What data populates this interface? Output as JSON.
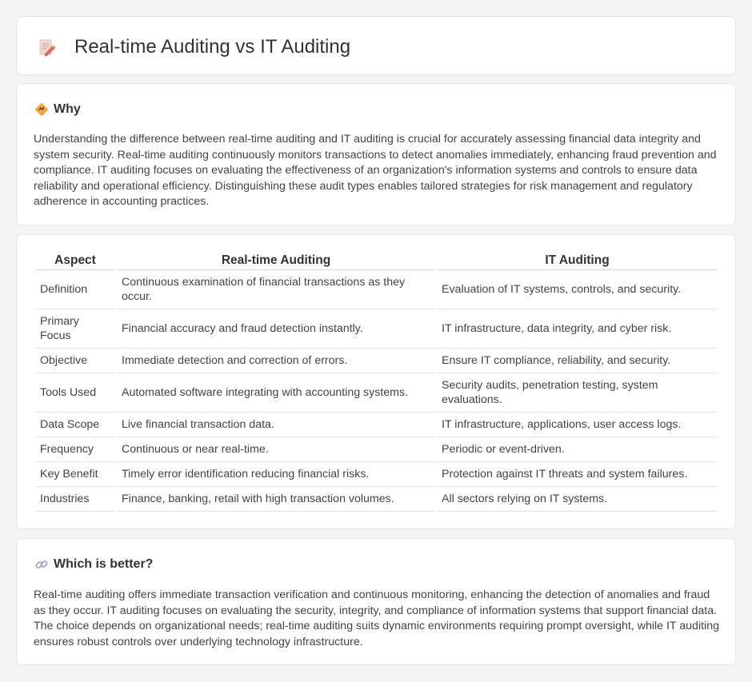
{
  "header": {
    "title": "Real-time Auditing vs IT Auditing",
    "icon": "edit-document-icon"
  },
  "why": {
    "heading": "Why",
    "icon": "diamond-sign-icon",
    "text": "Understanding the difference between real-time auditing and IT auditing is crucial for accurately assessing financial data integrity and system security. Real-time auditing continuously monitors transactions to detect anomalies immediately, enhancing fraud prevention and compliance. IT auditing focuses on evaluating the effectiveness of an organization's information systems and controls to ensure data reliability and operational efficiency. Distinguishing these audit types enables tailored strategies for risk management and regulatory adherence in accounting practices."
  },
  "table": {
    "headers": [
      "Aspect",
      "Real-time Auditing",
      "IT Auditing"
    ],
    "rows": [
      [
        "Definition",
        "Continuous examination of financial transactions as they occur.",
        "Evaluation of IT systems, controls, and security."
      ],
      [
        "Primary Focus",
        "Financial accuracy and fraud detection instantly.",
        "IT infrastructure, data integrity, and cyber risk."
      ],
      [
        "Objective",
        "Immediate detection and correction of errors.",
        "Ensure IT compliance, reliability, and security."
      ],
      [
        "Tools Used",
        "Automated software integrating with accounting systems.",
        "Security audits, penetration testing, system evaluations."
      ],
      [
        "Data Scope",
        "Live financial transaction data.",
        "IT infrastructure, applications, user access logs."
      ],
      [
        "Frequency",
        "Continuous or near real-time.",
        "Periodic or event-driven."
      ],
      [
        "Key Benefit",
        "Timely error identification reducing financial risks.",
        "Protection against IT threats and system failures."
      ],
      [
        "Industries",
        "Finance, banking, retail with high transaction volumes.",
        "All sectors relying on IT systems."
      ]
    ]
  },
  "better": {
    "heading": "Which is better?",
    "icon": "link-icon",
    "text": "Real-time auditing offers immediate transaction verification and continuous monitoring, enhancing the detection of anomalies and fraud as they occur. IT auditing focuses on evaluating the security, integrity, and compliance of information systems that support financial data. The choice depends on organizational needs; real-time auditing suits dynamic environments requiring prompt oversight, while IT auditing ensures robust controls over underlying technology infrastructure."
  },
  "colors": {
    "background": "#f3f4f6",
    "card": "#ffffff",
    "border": "#e3e5e8",
    "accent_orange": "#f4a53c",
    "icon_red": "#e46a5c"
  }
}
